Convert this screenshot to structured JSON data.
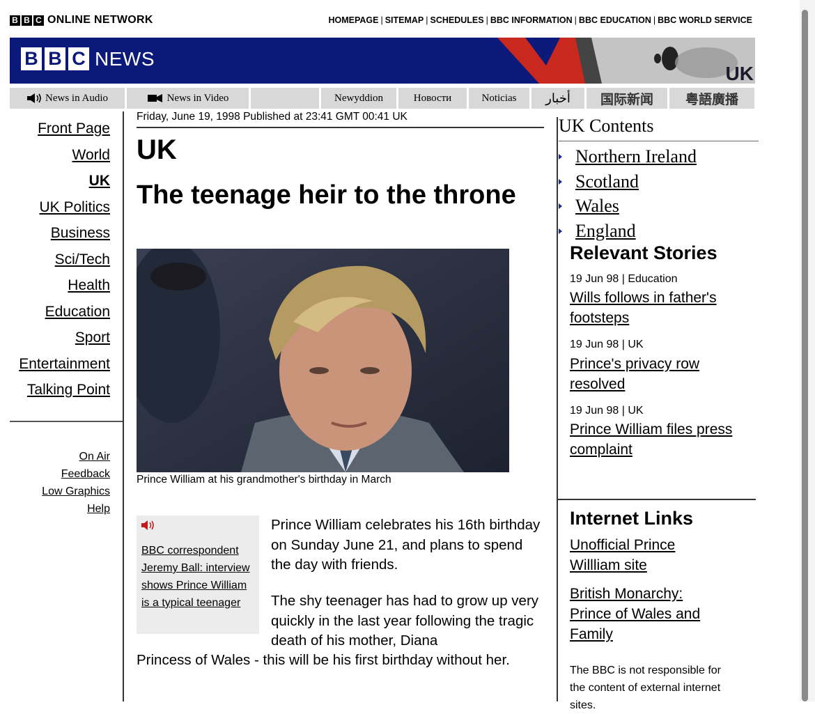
{
  "network": {
    "logo_letters": [
      "B",
      "B",
      "C"
    ],
    "title": "ONLINE NETWORK",
    "links": [
      "HOMEPAGE",
      "SITEMAP",
      "SCHEDULES",
      "BBC INFORMATION",
      "BBC EDUCATION",
      "BBC WORLD SERVICE"
    ]
  },
  "banner": {
    "logo_letters": [
      "B",
      "B",
      "C"
    ],
    "logo_text": "NEWS",
    "region": "UK",
    "colors": {
      "navy": "#0b1a7a",
      "red": "#c8281e",
      "grey": "#bdbdbd"
    }
  },
  "tabs": {
    "audio": "News in Audio",
    "video": "News in Video",
    "welsh": "Newyddion",
    "russian": "Новости",
    "spanish": "Noticias",
    "arabic": "أخبار",
    "chinese": "国际新闻",
    "cantonese": "粤語廣播"
  },
  "nav": {
    "items": [
      "Front Page",
      "World",
      "UK",
      "UK Politics",
      "Business",
      "Sci/Tech",
      "Health",
      "Education",
      "Sport",
      "Entertainment",
      "Talking Point"
    ],
    "active": "UK",
    "utility": [
      "On Air",
      "Feedback",
      "Low Graphics",
      "Help"
    ]
  },
  "article": {
    "dateline": "Friday, June 19, 1998 Published at 23:41 GMT 00:41 UK",
    "section": "UK",
    "headline": "The teenage heir to the throne",
    "photo_caption": "Prince William at his grandmother's birthday in March",
    "audio_link": "BBC correspondent Jeremy Ball: interview shows Prince William is a typical teenager",
    "para1": "Prince William celebrates his 16th birthday on Sunday June 21, and plans to spend the day with friends.",
    "para2_a": "The shy teenager has had to grow up very quickly in the last year following the tragic death of his mother, Diana",
    "para2_b": "Princess of Wales - this will be his first birthday without her."
  },
  "right": {
    "uk_contents_title": "UK Contents",
    "uk_contents": [
      "Northern Ireland",
      "Scotland",
      "Wales",
      "England"
    ],
    "relevant_title": "Relevant Stories",
    "stories": [
      {
        "meta": "19 Jun 98 | Education",
        "title": "Wills follows in father's footsteps"
      },
      {
        "meta": "19 Jun 98 | UK",
        "title": "Prince's privacy row resolved"
      },
      {
        "meta": "19 Jun 98 | UK",
        "title": "Prince William files press complaint"
      }
    ],
    "internet_title": "Internet Links",
    "internet_links": [
      "Unofficial Prince Willliam site",
      "British Monarchy: Prince of Wales and Family"
    ],
    "disclaimer": "The BBC is not responsible for the content of external internet sites."
  }
}
